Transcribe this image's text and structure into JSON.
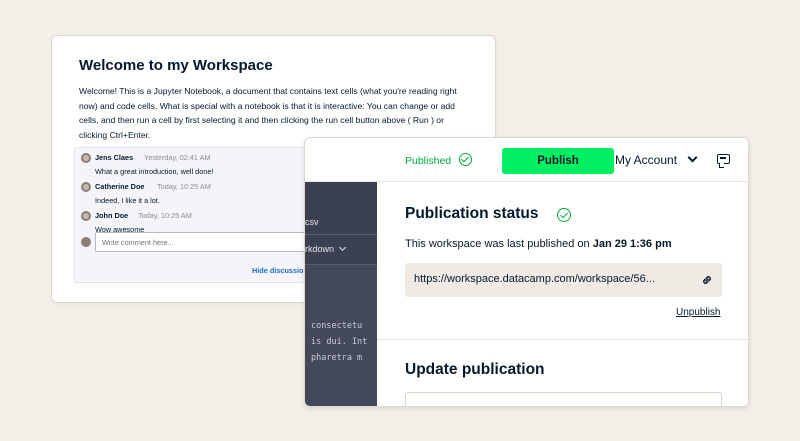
{
  "notebook": {
    "title": "Welcome to my Workspace",
    "body": "Welcome! This is a Jupyter Notebook, a document that contains text cells (what you're reading right now) and code cells. What is special with a notebook is that it is interactive: You can change or add cells, and then run a cell by first selecting it and then clicking the run cell button above ( Run ) or clicking Ctrl+Enter.",
    "comments": [
      {
        "name": "Jens Claes",
        "time": "Yesterday, 02:41 AM",
        "text": "What a great introduction, well done!"
      },
      {
        "name": "Catherine Doe",
        "time": "Today, 10:25 AM",
        "text": "Indeed, I like it a lot."
      },
      {
        "name": "John Doe",
        "time": "Today, 10:25 AM",
        "text": "Wow awesome"
      }
    ],
    "comment_placeholder": "Write comment here...",
    "hide_link": "Hide discussion"
  },
  "publish_panel": {
    "published_label": "Published",
    "publish_button": "Publish",
    "account_label": "My Account",
    "editor": {
      "line1": "csv",
      "line2": "rkdown",
      "code_lines": [
        "consectetu",
        "is dui. Int",
        "pharetra m"
      ]
    },
    "status_title": "Publication status",
    "last_published_prefix": "This workspace was last published on",
    "last_published_date": "Jan 29 1:36 pm",
    "url": "https://workspace.datacamp.com/workspace/56...",
    "unpublish_label": "Unpublish",
    "update_title": "Update publication"
  },
  "colors": {
    "background": "#f3efe8",
    "accent_green": "#03ef62",
    "published_green": "#03a83e",
    "text_navy": "#05192d",
    "link_blue": "#1e6fc2",
    "editor_dark": "#43485a"
  },
  "icons": [
    "check-circle-icon",
    "chevron-down-icon",
    "chat-icon",
    "link-icon",
    "avatar"
  ]
}
